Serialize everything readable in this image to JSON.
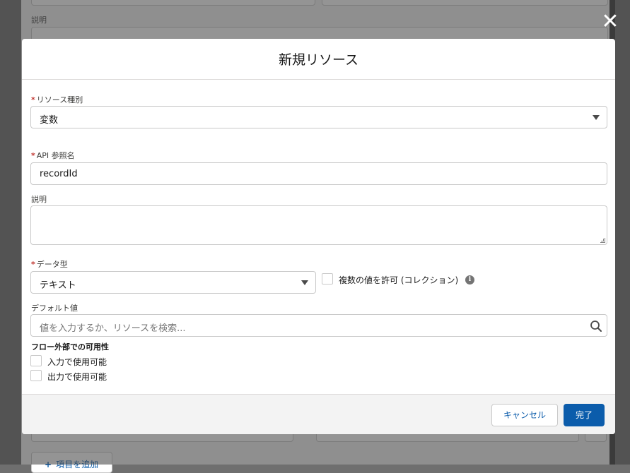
{
  "background": {
    "description_label": "説明",
    "add_item_label": "項目を追加"
  },
  "modal": {
    "title": "新規リソース",
    "resource_type": {
      "label": "リソース種別",
      "value": "変数"
    },
    "api_name": {
      "label": "API 参照名",
      "value": "recordId"
    },
    "description": {
      "label": "説明",
      "value": ""
    },
    "data_type": {
      "label": "データ型",
      "value": "テキスト"
    },
    "allow_multiple": {
      "label": "複数の値を許可 (コレクション)",
      "checked": false
    },
    "default_value": {
      "label": "デフォルト値",
      "placeholder": "値を入力するか、リソースを検索..."
    },
    "availability": {
      "title": "フロー外部での可用性",
      "input_label": "入力で使用可能",
      "output_label": "出力で使用可能"
    },
    "footer": {
      "cancel_label": "キャンセル",
      "done_label": "完了"
    }
  },
  "icons": {
    "close": "close-icon",
    "caret": "chevron-down-icon",
    "info": "info-icon",
    "search": "search-icon"
  },
  "colors": {
    "brand": "#0b5cab",
    "required": "#c23934"
  }
}
